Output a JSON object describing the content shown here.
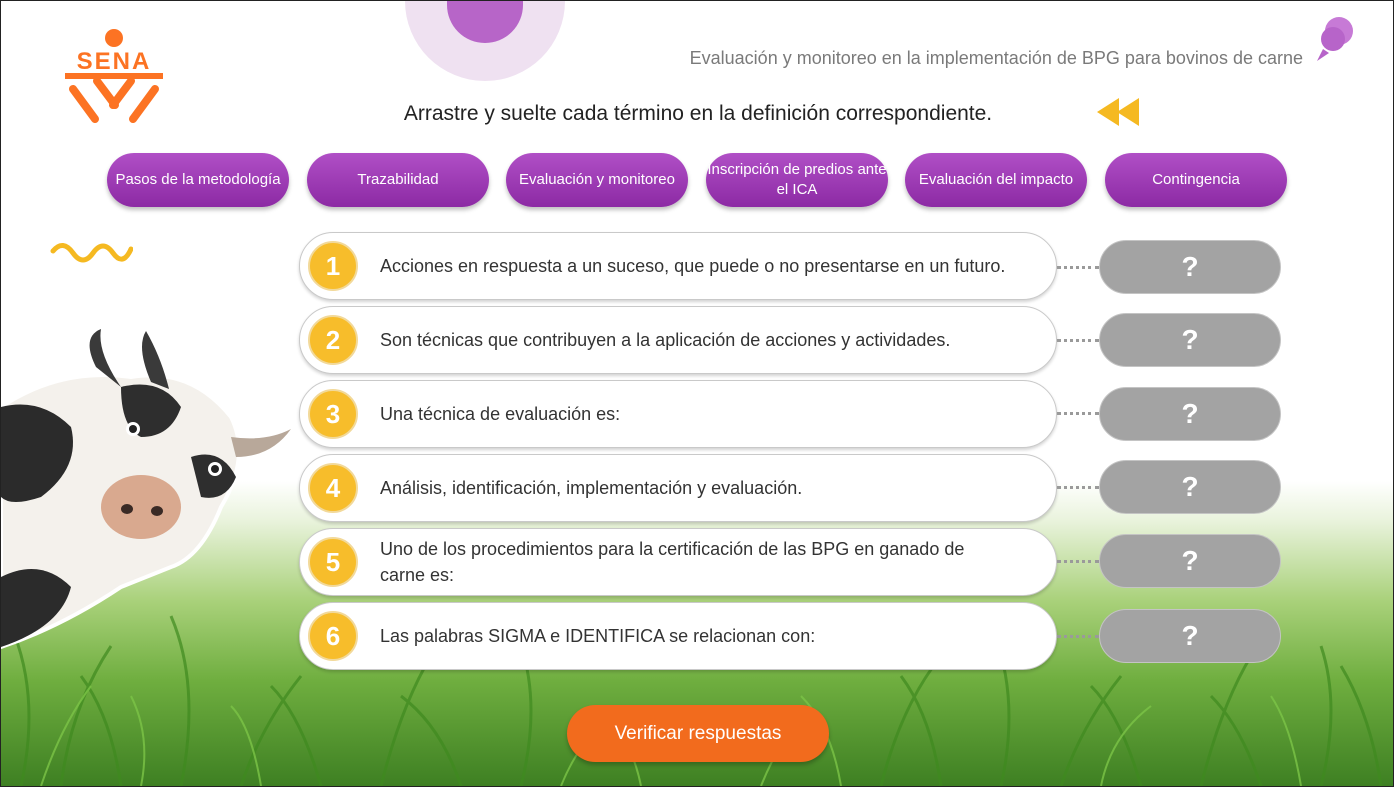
{
  "header": {
    "title": "Evaluación y monitoreo en la implementación de BPG para bovinos de carne",
    "logo_text": "SENA"
  },
  "instructions": "Arrastre y suelte cada término en la definición correspondiente.",
  "terms": [
    {
      "label": "Pasos de la metodología"
    },
    {
      "label": "Trazabilidad"
    },
    {
      "label": "Evaluación y monitoreo"
    },
    {
      "label": "Inscripción de predios ante el ICA"
    },
    {
      "label": "Evaluación del impacto"
    },
    {
      "label": "Contingencia"
    }
  ],
  "questions": [
    {
      "number": "1",
      "text": "Acciones en respuesta a un suceso, que puede o no presentarse en un futuro.",
      "answer": "?"
    },
    {
      "number": "2",
      "text": "Son técnicas que contribuyen a la aplicación de acciones y  actividades.",
      "answer": "?"
    },
    {
      "number": "3",
      "text": "Una técnica de evaluación es:",
      "answer": "?"
    },
    {
      "number": "4",
      "text": "Análisis, identificación, implementación  y evaluación.",
      "answer": "?"
    },
    {
      "number": "5",
      "text": "Uno de los  procedimientos para la certificación de las  BPG en ganado de carne es:",
      "answer": "?"
    },
    {
      "number": "6",
      "text": "Las palabras SIGMA e  IDENTIFICA se relacionan con:",
      "answer": "?"
    }
  ],
  "verify_label": "Verificar respuestas",
  "colors": {
    "accent_purple": "#9b36b3",
    "number_yellow": "#f7bd2b",
    "button_orange": "#f26b1d",
    "sena_orange": "#fc7323",
    "dropzone_gray": "#a3a3a3"
  },
  "icons": [
    "sena-logo",
    "pin-icon",
    "rewind-icon",
    "squiggle-decoration",
    "cow-illustration"
  ]
}
